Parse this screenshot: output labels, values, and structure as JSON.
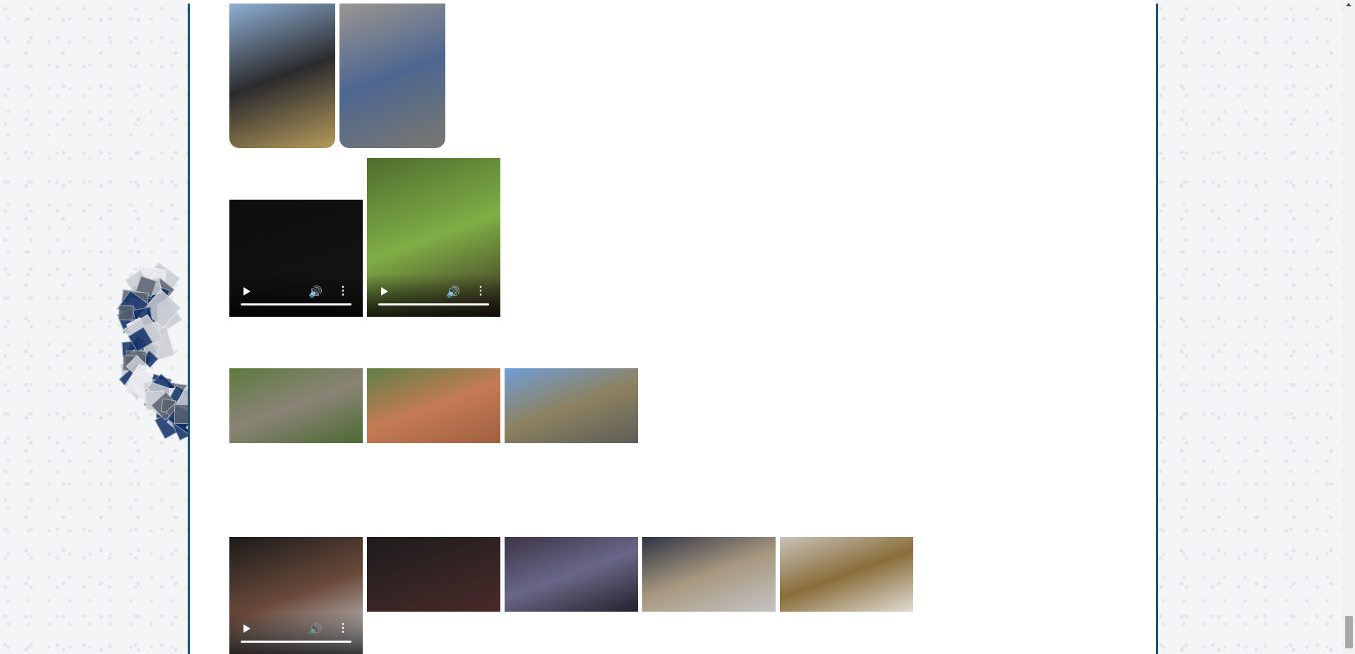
{
  "colors": {
    "frame_border": "#1b4f7a",
    "swirl_dark": "#0f2f66",
    "content_bg": "#ffffff"
  },
  "icons": {
    "play": "play-icon",
    "volume": "volume-icon",
    "menu": "more-vertical-icon"
  },
  "gallery": {
    "row1": [
      {
        "name": "photo-person-kneeling-rifle",
        "colors": [
          "#8fb0d4",
          "#2b2b2e",
          "#b59a5a"
        ]
      },
      {
        "name": "photo-person-sitting-wall",
        "colors": [
          "#9a9690",
          "#4d6690",
          "#7a7870"
        ]
      }
    ],
    "row2": [
      {
        "name": "video-dark",
        "colors": [
          "#0d0d0d",
          "#151515"
        ]
      },
      {
        "name": "video-shooting-range",
        "colors": [
          "#4e6d2f",
          "#7fae45",
          "#3a2d22"
        ]
      }
    ],
    "row3": [
      {
        "name": "photo-canyon-trees",
        "colors": [
          "#5d7a3e",
          "#8a8476",
          "#4b6a33"
        ]
      },
      {
        "name": "photo-red-dirt-valley",
        "colors": [
          "#5f7f45",
          "#c47b55",
          "#a06040"
        ]
      },
      {
        "name": "photo-train-plains",
        "colors": [
          "#6f9ed6",
          "#8d8260",
          "#5c5e58"
        ]
      }
    ],
    "row4": [
      {
        "name": "video-phone-screen",
        "colors": [
          "#1a1a1a",
          "#6a4a3a",
          "#d8dde2"
        ]
      },
      {
        "name": "photo-phone-dark",
        "colors": [
          "#1c1c1c",
          "#4a2a2a"
        ]
      },
      {
        "name": "photo-game-screenshot",
        "colors": [
          "#3a3548",
          "#6a6688",
          "#24222c"
        ]
      },
      {
        "name": "photo-flashlight-hand",
        "colors": [
          "#2e3444",
          "#a89880",
          "#c4c4c4"
        ]
      },
      {
        "name": "photo-woven-wall",
        "colors": [
          "#c8c3ba",
          "#8a6d3a",
          "#e0dcd4"
        ]
      }
    ]
  }
}
